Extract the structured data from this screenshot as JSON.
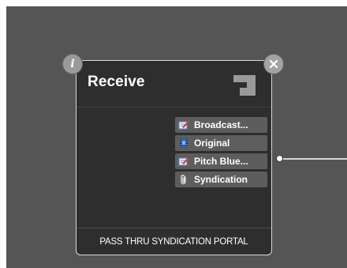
{
  "node": {
    "title": "Receive",
    "type_icon": "receive-hook-icon",
    "info_label": "i",
    "close_icon": "close-icon",
    "outputs": [
      {
        "label": "Broadcast...",
        "icon": "edit-document-icon"
      },
      {
        "label": "Original",
        "icon": "film-icon"
      },
      {
        "label": "Pitch Blue...",
        "icon": "edit-document-icon"
      },
      {
        "label": "Syndication",
        "icon": "paperclip-icon"
      }
    ],
    "footer": "PASS THRU SYNDICATION PORTAL"
  },
  "colors": {
    "canvas_bg": "#555555",
    "node_bg": "#2e2e2e",
    "node_border": "#d8d8d8",
    "output_bg": "#5d5d5d",
    "text": "#ffffff"
  }
}
